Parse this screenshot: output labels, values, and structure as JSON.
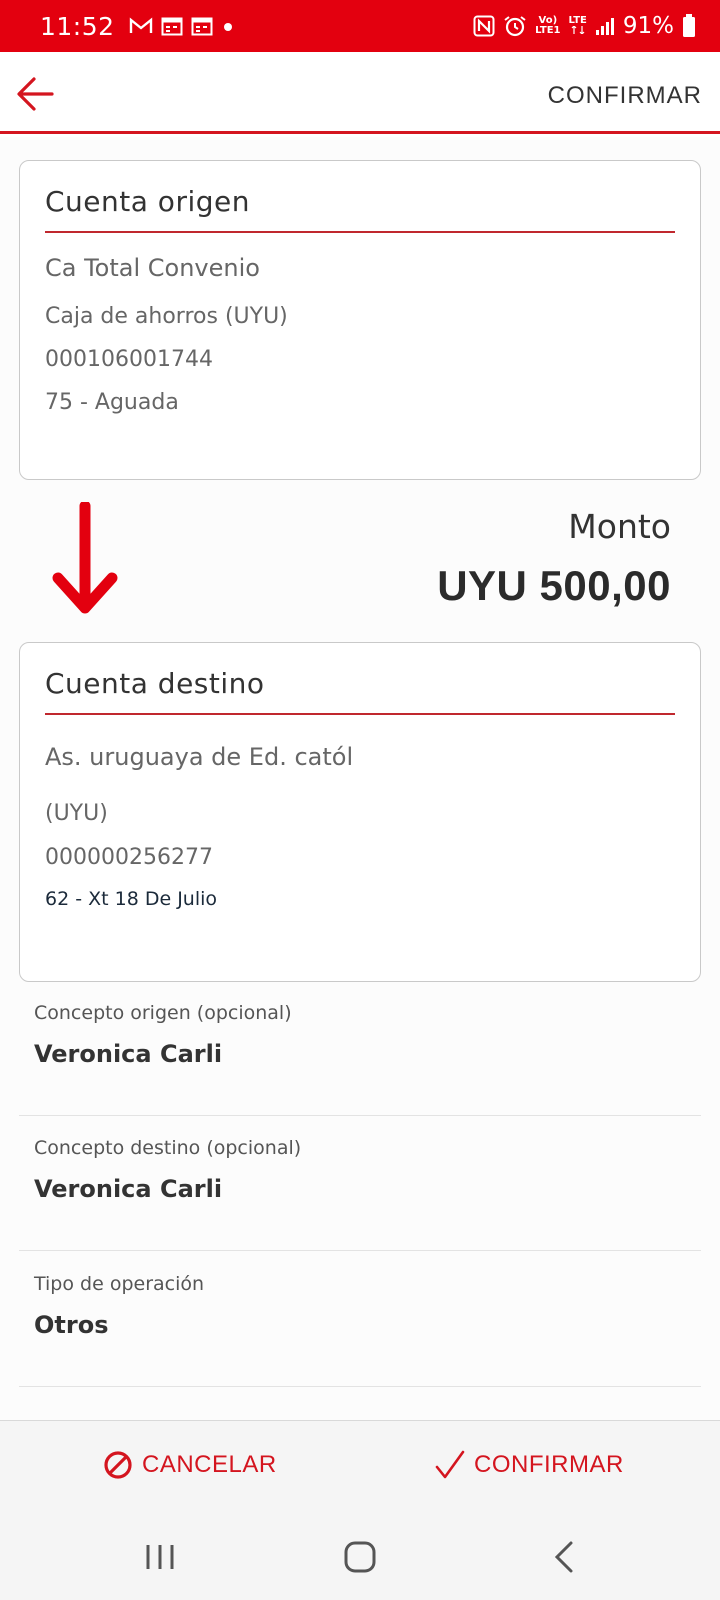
{
  "status_bar": {
    "time": "11:52",
    "battery": "91%",
    "net_top": "Vo)",
    "net_bottom": "LTE1",
    "lte_label": "LTE",
    "left_icons": [
      "gmail-icon",
      "calendar-icon",
      "calendar-icon",
      "dot-icon"
    ],
    "right_icons": [
      "nfc-icon",
      "alarm-icon",
      "volte-icon",
      "lte-icon",
      "signal-icon",
      "battery-icon"
    ]
  },
  "app_bar": {
    "back_icon": "arrow-left-icon",
    "confirm_label": "CONFIRMAR"
  },
  "origin": {
    "title": "Cuenta origen",
    "name": "Ca Total Convenio",
    "type": "Caja de ahorros (UYU)",
    "number": "000106001744",
    "branch": "75 - Aguada"
  },
  "amount": {
    "label": "Monto",
    "value": "UYU 500,00"
  },
  "destination": {
    "title": "Cuenta destino",
    "name": "As. uruguaya de Ed. catól",
    "type": "(UYU)",
    "number": "000000256277",
    "branch": "62 - Xt 18 De Julio"
  },
  "fields": [
    {
      "label": "Concepto origen (opcional)",
      "value": "Veronica Carli"
    },
    {
      "label": "Concepto destino (opcional)",
      "value": "Veronica Carli"
    },
    {
      "label": "Tipo de operación",
      "value": "Otros"
    }
  ],
  "actions": {
    "cancel_label": "CANCELAR",
    "confirm_label": "CONFIRMAR"
  },
  "colors": {
    "brand_red": "#e3000f",
    "accent_red": "#d4151f"
  }
}
